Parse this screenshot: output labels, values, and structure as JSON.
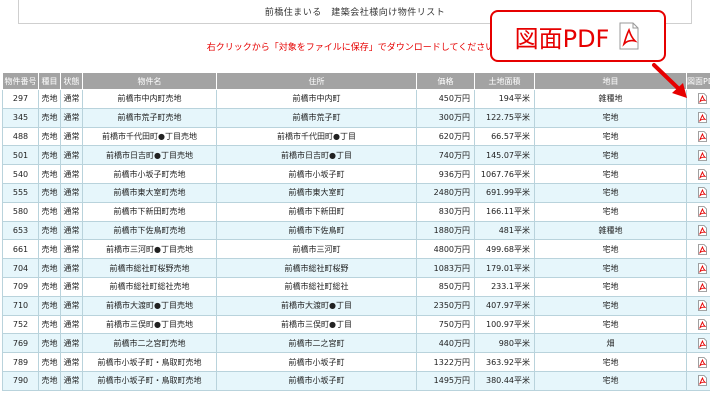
{
  "header": {
    "title": "前橋住まいる　建築会社様向け物件リスト"
  },
  "notice": "右クリックから「対象をファイルに保存」でダウンロードしてください。",
  "callout": {
    "label": "図面PDF",
    "icon": "pdf-icon"
  },
  "colors": {
    "accent": "#e60000",
    "header_bg": "#a3a3a3",
    "row_alt": "#e6f6fb"
  },
  "table": {
    "columns": [
      "物件番号",
      "種目",
      "状態",
      "物件名",
      "住所",
      "価格",
      "土地面積",
      "地目",
      "図面PDF"
    ],
    "rows": [
      [
        "297",
        "売地",
        "通常",
        "前橋市中内町売地",
        "前橋市中内町",
        "450万円",
        "194平米",
        "雑種地"
      ],
      [
        "345",
        "売地",
        "通常",
        "前橋市荒子町売地",
        "前橋市荒子町",
        "300万円",
        "122.75平米",
        "宅地"
      ],
      [
        "488",
        "売地",
        "通常",
        "前橋市千代田町●丁目売地",
        "前橋市千代田町●丁目",
        "620万円",
        "66.57平米",
        "宅地"
      ],
      [
        "501",
        "売地",
        "通常",
        "前橋市日吉町●丁目売地",
        "前橋市日吉町●丁目",
        "740万円",
        "145.07平米",
        "宅地"
      ],
      [
        "540",
        "売地",
        "通常",
        "前橋市小坂子町売地",
        "前橋市小坂子町",
        "936万円",
        "1067.76平米",
        "宅地"
      ],
      [
        "555",
        "売地",
        "通常",
        "前橋市東大室町売地",
        "前橋市東大室町",
        "2480万円",
        "691.99平米",
        "宅地"
      ],
      [
        "580",
        "売地",
        "通常",
        "前橋市下新田町売地",
        "前橋市下新田町",
        "830万円",
        "166.11平米",
        "宅地"
      ],
      [
        "653",
        "売地",
        "通常",
        "前橋市下佐鳥町売地",
        "前橋市下佐鳥町",
        "1880万円",
        "481平米",
        "雑種地"
      ],
      [
        "661",
        "売地",
        "通常",
        "前橋市三河町●丁目売地",
        "前橋市三河町",
        "4800万円",
        "499.68平米",
        "宅地"
      ],
      [
        "704",
        "売地",
        "通常",
        "前橋市総社町桜野売地",
        "前橋市総社町桜野",
        "1083万円",
        "179.01平米",
        "宅地"
      ],
      [
        "709",
        "売地",
        "通常",
        "前橋市総社町総社売地",
        "前橋市総社町総社",
        "850万円",
        "233.1平米",
        "宅地"
      ],
      [
        "710",
        "売地",
        "通常",
        "前橋市大渡町●丁目売地",
        "前橋市大渡町●丁目",
        "2350万円",
        "407.97平米",
        "宅地"
      ],
      [
        "752",
        "売地",
        "通常",
        "前橋市三俣町●丁目売地",
        "前橋市三俣町●丁目",
        "750万円",
        "100.97平米",
        "宅地"
      ],
      [
        "769",
        "売地",
        "通常",
        "前橋市二之宮町売地",
        "前橋市二之宮町",
        "440万円",
        "980平米",
        "畑"
      ],
      [
        "789",
        "売地",
        "通常",
        "前橋市小坂子町・鳥取町売地",
        "前橋市小坂子町",
        "1322万円",
        "363.92平米",
        "宅地"
      ],
      [
        "790",
        "売地",
        "通常",
        "前橋市小坂子町・鳥取町売地",
        "前橋市小坂子町",
        "1495万円",
        "380.44平米",
        "宅地"
      ]
    ]
  }
}
